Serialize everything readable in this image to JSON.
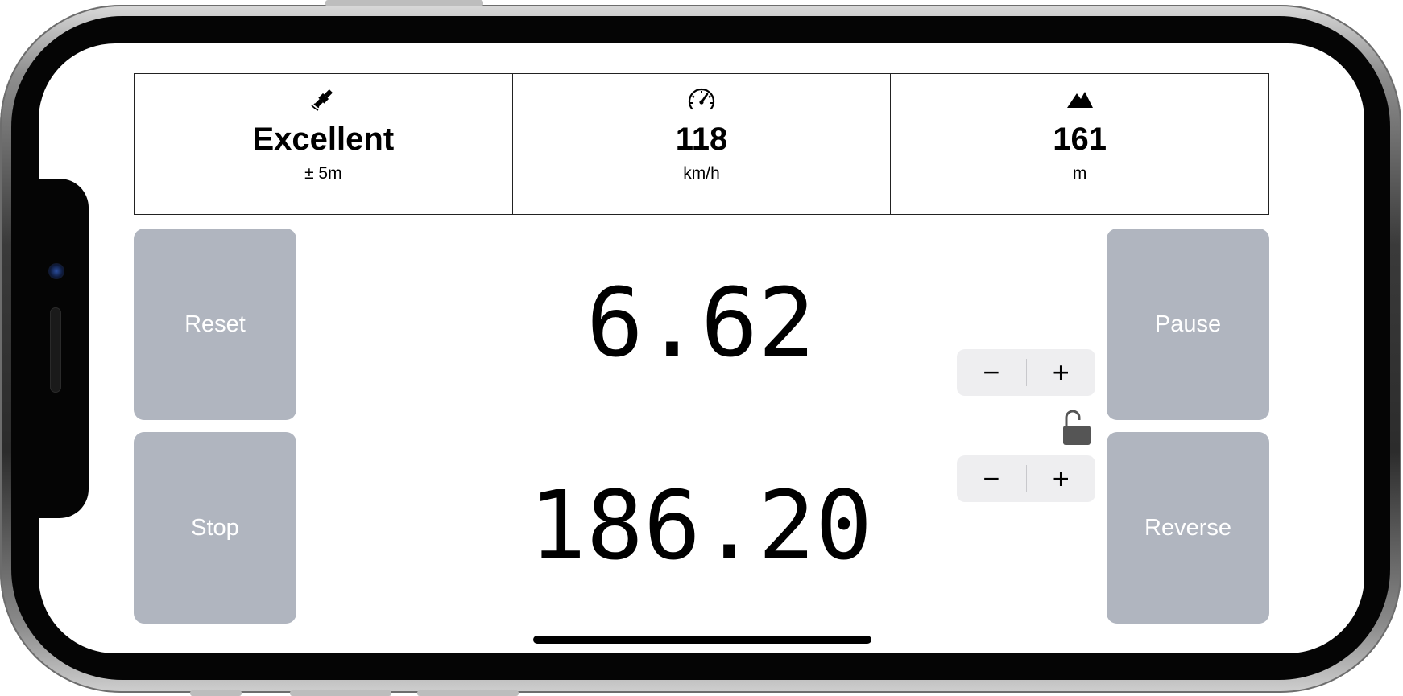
{
  "info": {
    "gps": {
      "icon": "satellite-icon",
      "value": "Excellent",
      "unit": "± 5m"
    },
    "speed": {
      "icon": "speedometer-icon",
      "value": "118",
      "unit": "km/h"
    },
    "altitude": {
      "icon": "mountain-icon",
      "value": "161",
      "unit": "m"
    }
  },
  "buttons": {
    "reset": "Reset",
    "stop": "Stop",
    "pause": "Pause",
    "reverse": "Reverse"
  },
  "readouts": {
    "primary": "6.62",
    "secondary": "186.20"
  },
  "steppers": {
    "top": {
      "minus": "−",
      "plus": "+"
    },
    "bottom": {
      "minus": "−",
      "plus": "+"
    }
  },
  "lock": {
    "icon": "unlocked-padlock-icon",
    "state": "unlocked"
  },
  "colors": {
    "button_bg": "#b0b5bf",
    "button_text": "#ffffff",
    "stepper_bg": "#eeeef0",
    "text": "#000000"
  }
}
